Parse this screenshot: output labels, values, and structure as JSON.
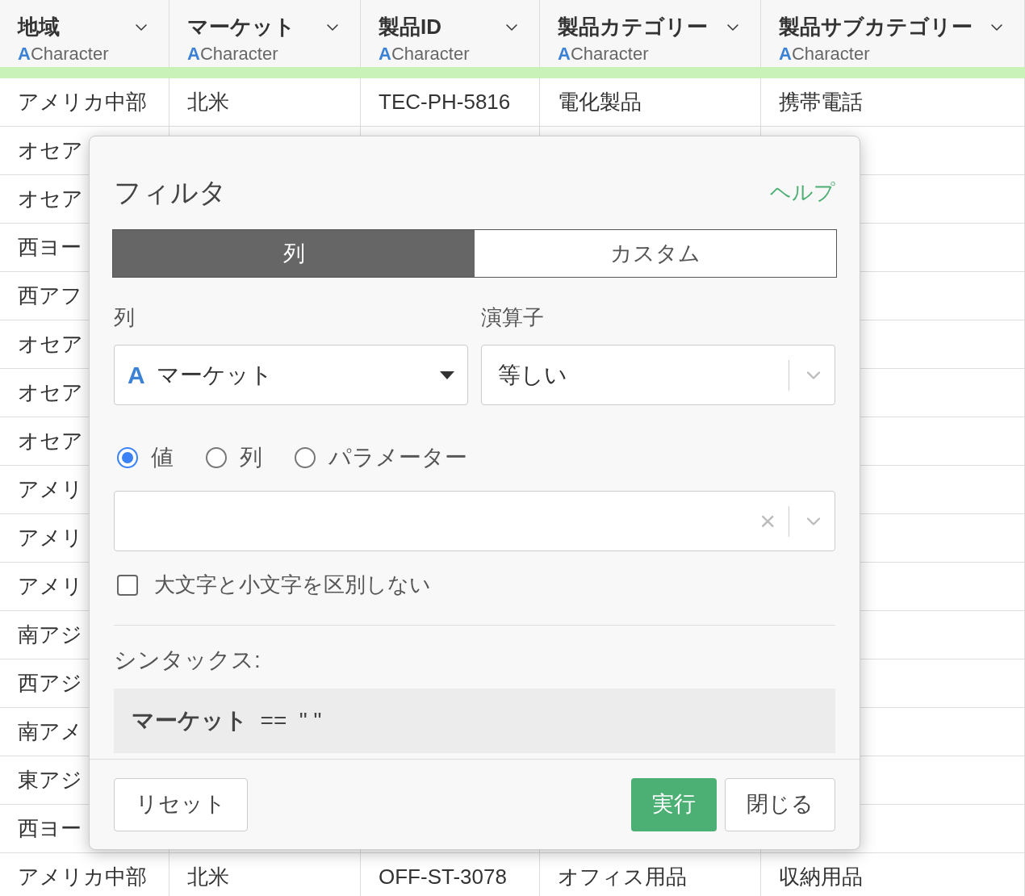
{
  "table": {
    "columns": [
      {
        "name": "地域",
        "type_icon": "A",
        "type": "Character"
      },
      {
        "name": "マーケット",
        "type_icon": "A",
        "type": "Character"
      },
      {
        "name": "製品ID",
        "type_icon": "A",
        "type": "Character"
      },
      {
        "name": "製品カテゴリー",
        "type_icon": "A",
        "type": "Character"
      },
      {
        "name": "製品サブカテゴリー",
        "type_icon": "A",
        "type": "Character"
      }
    ],
    "rows": [
      [
        "アメリカ中部",
        "北米",
        "TEC-PH-5816",
        "電化製品",
        "携帯電話"
      ],
      [
        "オセア"
      ],
      [
        "オセア"
      ],
      [
        "西ヨー"
      ],
      [
        "西アフ"
      ],
      [
        "オセア"
      ],
      [
        "オセア"
      ],
      [
        "オセア"
      ],
      [
        "アメリ"
      ],
      [
        "アメリ"
      ],
      [
        "アメリ"
      ],
      [
        "南アジ"
      ],
      [
        "西アジ"
      ],
      [
        "南アメ"
      ],
      [
        "東アジ"
      ],
      [
        "西ヨー"
      ],
      [
        "アメリカ中部",
        "北米",
        "OFF-ST-3078",
        "オフィス用品",
        "収納用品"
      ]
    ]
  },
  "dialog": {
    "title": "フィルタ",
    "help": "ヘルプ",
    "tabs": [
      {
        "label": "列",
        "selected": true
      },
      {
        "label": "カスタム",
        "selected": false
      }
    ],
    "column_label": "列",
    "column_value": "マーケット",
    "column_type": "A",
    "operator_label": "演算子",
    "operator_value": "等しい",
    "modes": [
      {
        "label": "値",
        "selected": true
      },
      {
        "label": "列",
        "selected": false
      },
      {
        "label": "パラメーター",
        "selected": false
      }
    ],
    "clear": "×",
    "ignore_case": {
      "label": "大文字と小文字を区別しない",
      "checked": false
    },
    "syntax_label": "シンタックス:",
    "syntax": "**マーケット**  ==  \" \"",
    "buttons": {
      "reset": "リセット",
      "run": "実行",
      "close": "閉じる"
    }
  }
}
